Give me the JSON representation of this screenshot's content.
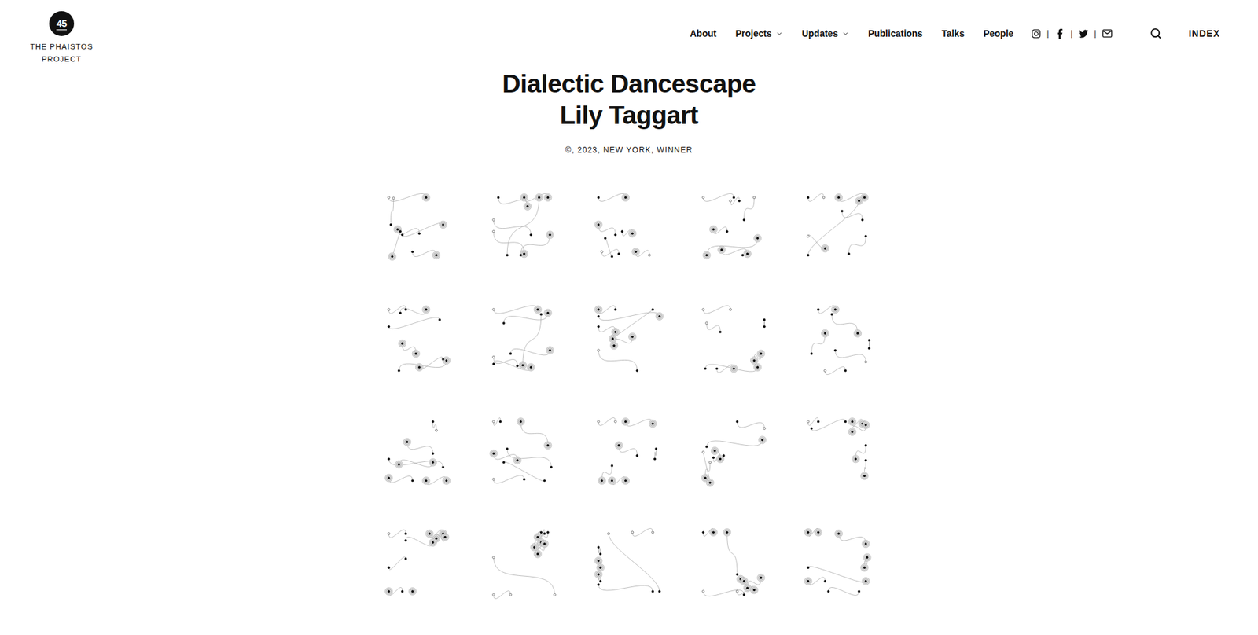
{
  "logo": {
    "number": "45",
    "name": "THE PHAISTOS PROJECT"
  },
  "nav": [
    {
      "label": "About",
      "dropdown": false
    },
    {
      "label": "Projects",
      "dropdown": true
    },
    {
      "label": "Updates",
      "dropdown": true
    },
    {
      "label": "Publications",
      "dropdown": false
    },
    {
      "label": "Talks",
      "dropdown": false
    },
    {
      "label": "People",
      "dropdown": false
    }
  ],
  "social_separators": [
    "|",
    "|",
    "|"
  ],
  "index_link": "INDEX",
  "title": "Dialectic Dancescape",
  "artist": "Lily Taggart",
  "meta": "©, 2023, NEW YORK, WINNER",
  "artworks": [
    {
      "dots": [
        [
          5,
          5,
          0
        ],
        [
          60,
          5,
          2
        ],
        [
          12,
          6,
          0
        ],
        [
          8,
          45,
          1
        ],
        [
          18,
          52,
          2
        ],
        [
          50,
          58,
          1
        ],
        [
          25,
          60,
          1
        ],
        [
          85,
          45,
          2
        ],
        [
          40,
          85,
          1
        ],
        [
          75,
          90,
          2
        ],
        [
          10,
          92,
          2
        ],
        [
          22,
          55,
          1
        ]
      ]
    },
    {
      "dots": [
        [
          12,
          5,
          1
        ],
        [
          55,
          18,
          2
        ],
        [
          50,
          5,
          2
        ],
        [
          85,
          5,
          2
        ],
        [
          5,
          38,
          0
        ],
        [
          60,
          60,
          1
        ],
        [
          72,
          5,
          2
        ],
        [
          25,
          90,
          1
        ],
        [
          5,
          55,
          0
        ],
        [
          50,
          88,
          2
        ],
        [
          88,
          60,
          2
        ],
        [
          45,
          90,
          1
        ]
      ]
    },
    {
      "dots": [
        [
          5,
          5,
          1
        ],
        [
          45,
          5,
          2
        ],
        [
          5,
          45,
          2
        ],
        [
          30,
          60,
          1
        ],
        [
          40,
          55,
          1
        ],
        [
          55,
          58,
          2
        ],
        [
          10,
          85,
          0
        ],
        [
          35,
          88,
          1
        ],
        [
          60,
          85,
          2
        ],
        [
          80,
          90,
          0
        ],
        [
          25,
          92,
          1
        ],
        [
          15,
          65,
          1
        ]
      ]
    },
    {
      "dots": [
        [
          5,
          5,
          0
        ],
        [
          50,
          5,
          1
        ],
        [
          45,
          10,
          0
        ],
        [
          58,
          10,
          1
        ],
        [
          80,
          5,
          0
        ],
        [
          65,
          38,
          1
        ],
        [
          20,
          52,
          2
        ],
        [
          40,
          55,
          1
        ],
        [
          85,
          65,
          2
        ],
        [
          10,
          90,
          2
        ],
        [
          32,
          82,
          2
        ],
        [
          70,
          88,
          2
        ],
        [
          63,
          90,
          1
        ]
      ]
    },
    {
      "dots": [
        [
          5,
          5,
          1
        ],
        [
          28,
          5,
          0
        ],
        [
          50,
          5,
          2
        ],
        [
          88,
          5,
          2
        ],
        [
          55,
          25,
          1
        ],
        [
          85,
          38,
          1
        ],
        [
          30,
          80,
          2
        ],
        [
          5,
          62,
          0
        ],
        [
          90,
          62,
          1
        ],
        [
          65,
          88,
          1
        ],
        [
          5,
          90,
          1
        ],
        [
          80,
          10,
          2
        ]
      ]
    },
    {
      "dots": [
        [
          5,
          5,
          0
        ],
        [
          30,
          5,
          1
        ],
        [
          60,
          5,
          2
        ],
        [
          22,
          10,
          1
        ],
        [
          5,
          30,
          1
        ],
        [
          80,
          20,
          1
        ],
        [
          25,
          55,
          2
        ],
        [
          45,
          70,
          2
        ],
        [
          90,
          80,
          2
        ],
        [
          20,
          95,
          1
        ],
        [
          50,
          90,
          2
        ],
        [
          85,
          78,
          1
        ]
      ]
    },
    {
      "dots": [
        [
          5,
          5,
          0
        ],
        [
          70,
          5,
          2
        ],
        [
          85,
          10,
          2
        ],
        [
          20,
          25,
          1
        ],
        [
          88,
          65,
          2
        ],
        [
          30,
          70,
          1
        ],
        [
          5,
          75,
          0
        ],
        [
          40,
          88,
          1
        ],
        [
          60,
          90,
          2
        ],
        [
          5,
          85,
          1
        ],
        [
          75,
          12,
          1
        ],
        [
          48,
          87,
          2
        ]
      ]
    },
    {
      "dots": [
        [
          5,
          5,
          2
        ],
        [
          30,
          5,
          1
        ],
        [
          5,
          15,
          1
        ],
        [
          95,
          15,
          2
        ],
        [
          5,
          30,
          1
        ],
        [
          30,
          38,
          2
        ],
        [
          55,
          45,
          2
        ],
        [
          28,
          58,
          2
        ],
        [
          5,
          65,
          0
        ],
        [
          62,
          95,
          1
        ],
        [
          26,
          48,
          2
        ],
        [
          85,
          5,
          1
        ]
      ]
    },
    {
      "dots": [
        [
          5,
          5,
          0
        ],
        [
          45,
          5,
          0
        ],
        [
          95,
          20,
          1
        ],
        [
          95,
          30,
          1
        ],
        [
          10,
          25,
          0
        ],
        [
          30,
          38,
          1
        ],
        [
          90,
          70,
          2
        ],
        [
          80,
          80,
          2
        ],
        [
          85,
          90,
          2
        ],
        [
          8,
          92,
          1
        ],
        [
          25,
          92,
          1
        ],
        [
          50,
          92,
          2
        ]
      ]
    },
    {
      "dots": [
        [
          20,
          5,
          1
        ],
        [
          45,
          5,
          2
        ],
        [
          40,
          12,
          1
        ],
        [
          78,
          40,
          2
        ],
        [
          95,
          50,
          1
        ],
        [
          95,
          62,
          1
        ],
        [
          30,
          40,
          2
        ],
        [
          10,
          70,
          1
        ],
        [
          45,
          65,
          1
        ],
        [
          90,
          82,
          0
        ],
        [
          30,
          95,
          0
        ],
        [
          60,
          95,
          1
        ]
      ]
    },
    {
      "dots": [
        [
          70,
          5,
          1
        ],
        [
          75,
          18,
          0
        ],
        [
          32,
          35,
          2
        ],
        [
          70,
          52,
          1
        ],
        [
          5,
          60,
          1
        ],
        [
          85,
          72,
          1
        ],
        [
          70,
          65,
          2
        ],
        [
          20,
          68,
          2
        ],
        [
          5,
          88,
          2
        ],
        [
          40,
          92,
          1
        ],
        [
          60,
          92,
          2
        ],
        [
          90,
          92,
          2
        ]
      ]
    },
    {
      "dots": [
        [
          5,
          5,
          0
        ],
        [
          15,
          5,
          1
        ],
        [
          45,
          5,
          2
        ],
        [
          85,
          40,
          2
        ],
        [
          5,
          52,
          2
        ],
        [
          40,
          62,
          2
        ],
        [
          25,
          45,
          1
        ],
        [
          90,
          72,
          1
        ],
        [
          5,
          90,
          0
        ],
        [
          50,
          90,
          1
        ],
        [
          80,
          92,
          1
        ],
        [
          20,
          65,
          1
        ]
      ]
    },
    {
      "dots": [
        [
          5,
          5,
          0
        ],
        [
          30,
          5,
          0
        ],
        [
          45,
          5,
          2
        ],
        [
          85,
          8,
          2
        ],
        [
          35,
          40,
          2
        ],
        [
          62,
          55,
          1
        ],
        [
          90,
          45,
          1
        ],
        [
          88,
          60,
          1
        ],
        [
          25,
          70,
          1
        ],
        [
          10,
          92,
          2
        ],
        [
          25,
          92,
          2
        ],
        [
          45,
          92,
          2
        ]
      ]
    },
    {
      "dots": [
        [
          55,
          5,
          1
        ],
        [
          95,
          15,
          0
        ],
        [
          92,
          32,
          2
        ],
        [
          10,
          42,
          1
        ],
        [
          20,
          58,
          1
        ],
        [
          30,
          60,
          2
        ],
        [
          35,
          55,
          1
        ],
        [
          22,
          48,
          2
        ],
        [
          15,
          65,
          0
        ],
        [
          8,
          88,
          2
        ],
        [
          15,
          95,
          2
        ],
        [
          5,
          50,
          0
        ]
      ]
    },
    {
      "dots": [
        [
          5,
          5,
          0
        ],
        [
          20,
          5,
          1
        ],
        [
          10,
          15,
          1
        ],
        [
          60,
          5,
          1
        ],
        [
          70,
          5,
          2
        ],
        [
          85,
          8,
          2
        ],
        [
          90,
          10,
          2
        ],
        [
          70,
          20,
          2
        ],
        [
          90,
          40,
          1
        ],
        [
          75,
          60,
          2
        ],
        [
          90,
          62,
          1
        ],
        [
          88,
          85,
          2
        ]
      ]
    },
    {
      "dots": [
        [
          5,
          5,
          0
        ],
        [
          30,
          5,
          1
        ],
        [
          65,
          5,
          2
        ],
        [
          85,
          5,
          2
        ],
        [
          88,
          10,
          2
        ],
        [
          75,
          12,
          2
        ],
        [
          70,
          18,
          2
        ],
        [
          30,
          15,
          1
        ],
        [
          5,
          55,
          1
        ],
        [
          30,
          42,
          1
        ],
        [
          5,
          90,
          2
        ],
        [
          25,
          90,
          1
        ],
        [
          40,
          90,
          2
        ]
      ]
    },
    {
      "dots": [
        [
          75,
          3,
          1
        ],
        [
          80,
          5,
          1
        ],
        [
          85,
          3,
          1
        ],
        [
          70,
          10,
          2
        ],
        [
          75,
          18,
          2
        ],
        [
          65,
          25,
          2
        ],
        [
          80,
          20,
          2
        ],
        [
          70,
          35,
          2
        ],
        [
          5,
          40,
          0
        ],
        [
          95,
          95,
          0
        ],
        [
          5,
          95,
          0
        ],
        [
          30,
          95,
          0
        ]
      ]
    },
    {
      "dots": [
        [
          55,
          3,
          0
        ],
        [
          85,
          3,
          0
        ],
        [
          5,
          25,
          1
        ],
        [
          8,
          35,
          1
        ],
        [
          5,
          45,
          2
        ],
        [
          8,
          55,
          2
        ],
        [
          5,
          65,
          2
        ],
        [
          8,
          75,
          1
        ],
        [
          5,
          80,
          1
        ],
        [
          85,
          90,
          1
        ],
        [
          95,
          90,
          1
        ],
        [
          20,
          5,
          0
        ]
      ]
    },
    {
      "dots": [
        [
          5,
          3,
          1
        ],
        [
          20,
          3,
          2
        ],
        [
          40,
          3,
          2
        ],
        [
          55,
          65,
          1
        ],
        [
          60,
          72,
          2
        ],
        [
          65,
          75,
          2
        ],
        [
          90,
          70,
          2
        ],
        [
          70,
          85,
          2
        ],
        [
          55,
          90,
          0
        ],
        [
          80,
          88,
          2
        ],
        [
          5,
          90,
          0
        ],
        [
          65,
          95,
          1
        ]
      ]
    },
    {
      "dots": [
        [
          5,
          3,
          2
        ],
        [
          20,
          3,
          2
        ],
        [
          50,
          5,
          2
        ],
        [
          90,
          20,
          2
        ],
        [
          92,
          40,
          2
        ],
        [
          88,
          55,
          2
        ],
        [
          90,
          75,
          2
        ],
        [
          5,
          55,
          1
        ],
        [
          5,
          75,
          2
        ],
        [
          30,
          75,
          1
        ],
        [
          80,
          90,
          1
        ],
        [
          35,
          90,
          1
        ]
      ]
    }
  ]
}
